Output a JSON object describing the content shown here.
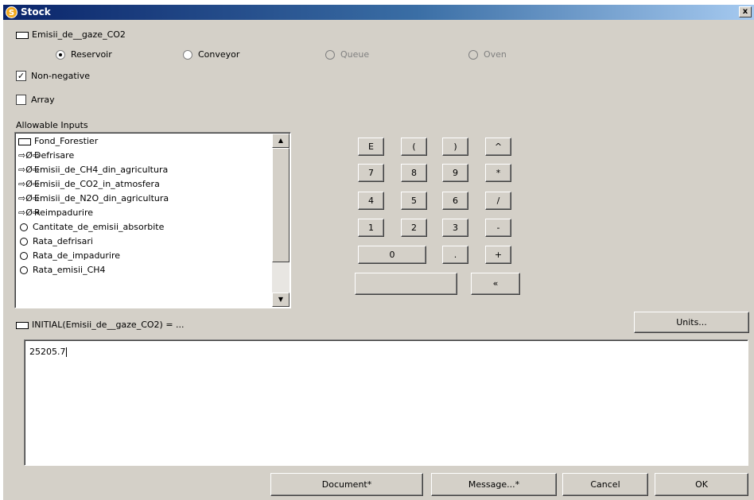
{
  "window": {
    "title": "Stock",
    "app_icon_letter": "S",
    "close_glyph": "x"
  },
  "stock_name": "Emisii_de__gaze_CO2",
  "stock_types": [
    {
      "label": "Reservoir",
      "checked": true,
      "enabled": true
    },
    {
      "label": "Conveyor",
      "checked": false,
      "enabled": true
    },
    {
      "label": "Queue",
      "checked": false,
      "enabled": false
    },
    {
      "label": "Oven",
      "checked": false,
      "enabled": false
    }
  ],
  "options": {
    "non_negative": {
      "label": "Non-negative",
      "checked": true,
      "mark": "✓"
    },
    "array": {
      "label": "Array",
      "checked": false
    }
  },
  "allowable_inputs": {
    "label": "Allowable Inputs",
    "items": [
      {
        "icon": "stock-icon",
        "glyph": "",
        "text": "Fond_Forestier"
      },
      {
        "icon": "flow-icon",
        "glyph": "⇨Ø⇨",
        "text": "Defrisare"
      },
      {
        "icon": "flow-icon",
        "glyph": "⇨Ø⇨",
        "text": "Emisii_de_CH4_din_agricultura"
      },
      {
        "icon": "flow-icon",
        "glyph": "⇨Ø⇨",
        "text": "Emisii_de_CO2_in_atmosfera"
      },
      {
        "icon": "flow-icon",
        "glyph": "⇨Ø⇨",
        "text": "Emisii_de_N2O_din_agricultura"
      },
      {
        "icon": "flow-icon",
        "glyph": "⇨Ø⇨",
        "text": "Reimpadurire"
      },
      {
        "icon": "converter-icon",
        "glyph": "",
        "text": "Cantitate_de_emisii_absorbite"
      },
      {
        "icon": "converter-icon",
        "glyph": "",
        "text": "Rata_defrisari"
      },
      {
        "icon": "converter-icon",
        "glyph": "",
        "text": "Rata_de_impadurire"
      },
      {
        "icon": "converter-icon",
        "glyph": "",
        "text": "Rata_emisii_CH4"
      }
    ],
    "scroll_up": "▲",
    "scroll_down": "▼"
  },
  "keypad": {
    "row1": [
      "E",
      "(",
      ")",
      "^"
    ],
    "row2": [
      "7",
      "8",
      "9",
      "*"
    ],
    "row3": [
      "4",
      "5",
      "6",
      "/"
    ],
    "row4": [
      "1",
      "2",
      "3",
      "-"
    ],
    "zero": "0",
    "dot": ".",
    "plus": "+",
    "blank": "",
    "backspace": "«"
  },
  "equation_label": "INITIAL(Emisii_de__gaze_CO2) = ...",
  "units_button": "Units...",
  "equation_value": "25205.7",
  "footer": {
    "document": "Document*",
    "message": "Message...*",
    "cancel": "Cancel",
    "ok": "OK"
  }
}
